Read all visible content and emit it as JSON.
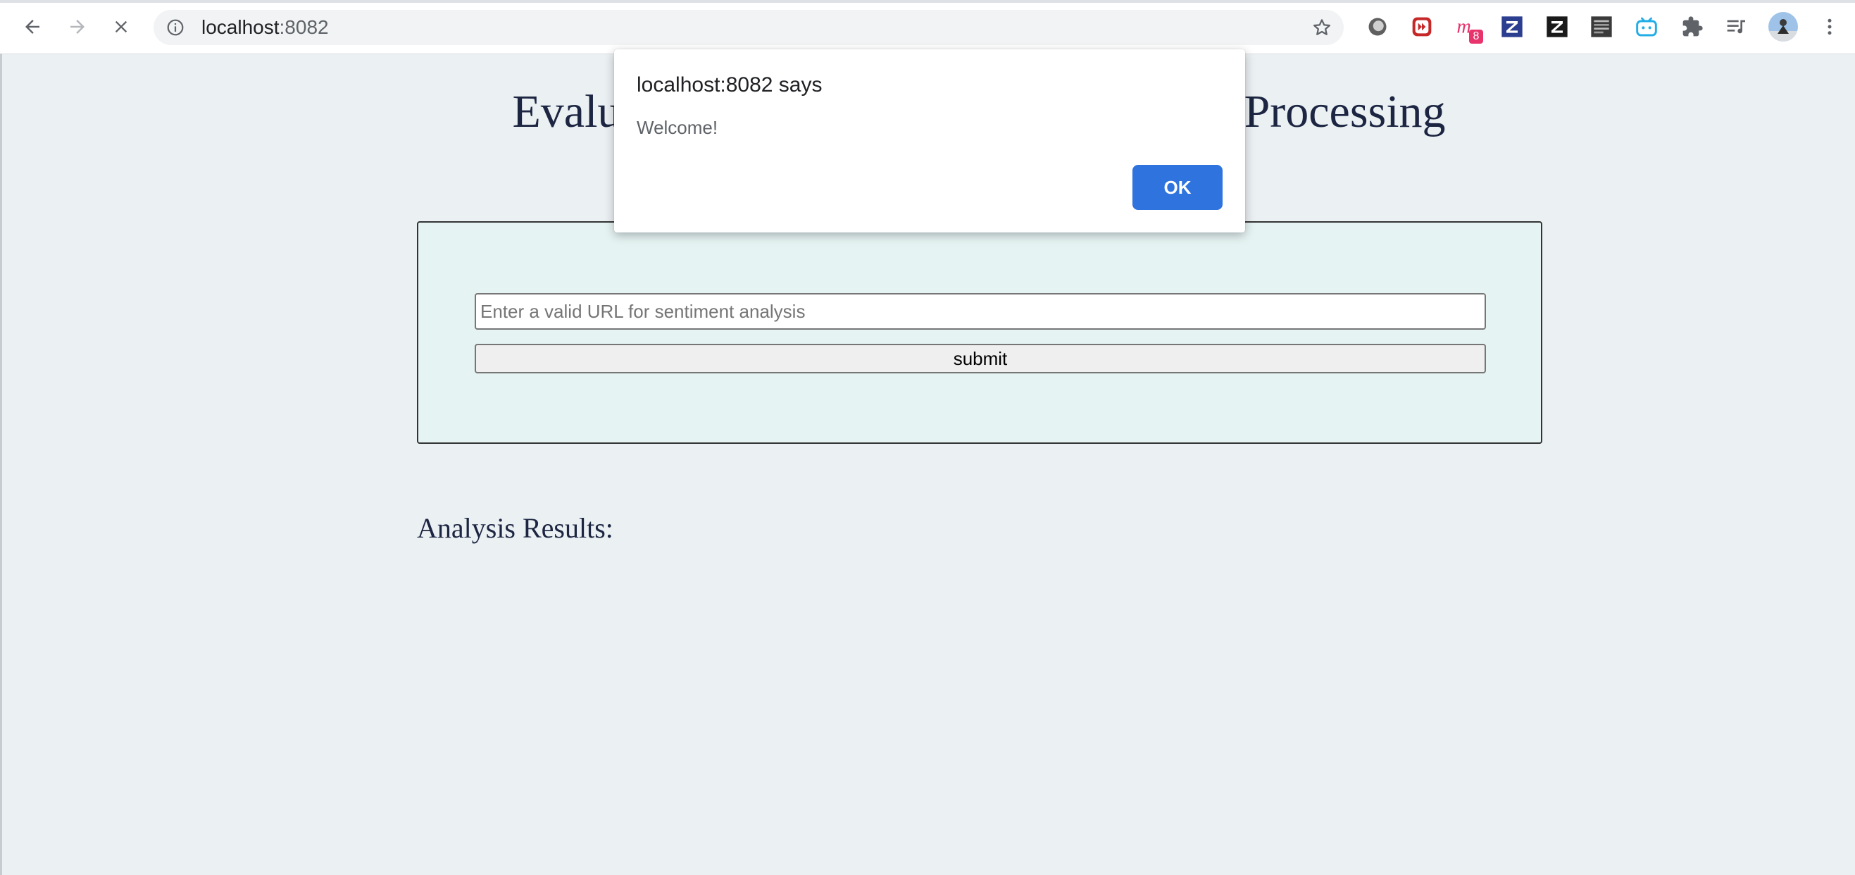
{
  "browser": {
    "url_host": "localhost",
    "url_port": ":8082",
    "extensions": [
      "ext-gray-circle-icon",
      "ext-red-play-icon",
      "ext-m-icon",
      "ext-zotero-blue-icon",
      "ext-zotero-black-icon",
      "ext-news-icon",
      "ext-bilibili-icon",
      "puzzle-icon",
      "media-queue-icon",
      "avatar",
      "more-menu-icon"
    ],
    "ext_badge": "8"
  },
  "page": {
    "title": "Evaluate News with Natural Language Processing",
    "url_placeholder": "Enter a valid URL for sentiment analysis",
    "submit_label": "submit",
    "results_heading": "Analysis Results:"
  },
  "dialog": {
    "title": "localhost:8082 says",
    "message": "Welcome!",
    "ok_label": "OK"
  },
  "colors": {
    "page_bg": "#ebf0f3",
    "panel_bg": "#e5f3f2",
    "title_color": "#1c2541",
    "ok_button": "#2f73df"
  }
}
